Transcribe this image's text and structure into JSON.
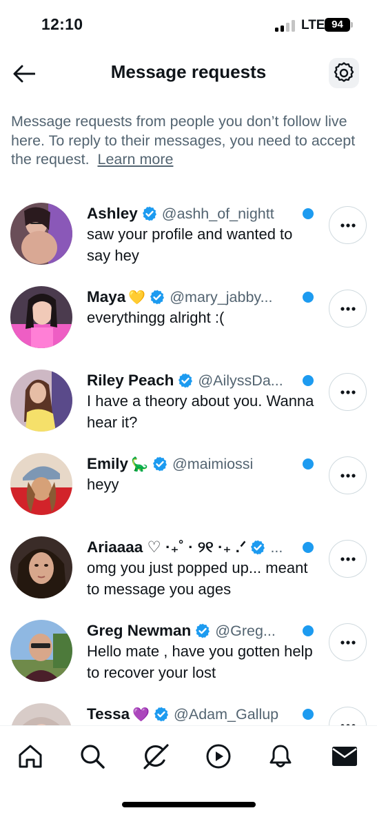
{
  "status_bar": {
    "time": "12:10",
    "network": "LTE",
    "battery": "94"
  },
  "header": {
    "title": "Message requests",
    "back_icon": "arrow-left-icon",
    "settings_icon": "gear-icon"
  },
  "description": {
    "text": "Message requests from people you don’t follow live here. To reply to their messages, you need to accept the request.",
    "link": "Learn more"
  },
  "requests": [
    {
      "name": "Ashley",
      "emoji": "",
      "verified": true,
      "handle": "@ashh_of_nightt",
      "preview": "saw your profile and wanted to say hey",
      "unread": true
    },
    {
      "name": "Maya",
      "emoji": "💛",
      "verified": true,
      "handle": "@mary_jabby...",
      "preview": "everythingg alright :(",
      "unread": true
    },
    {
      "name": "Riley Peach",
      "emoji": "",
      "verified": true,
      "handle": "@AilyssDa...",
      "preview": "I have a theory about you. Wanna hear it?",
      "unread": true
    },
    {
      "name": "Emily",
      "emoji": "🦕",
      "verified": true,
      "handle": "@maimiossi",
      "preview": "heyy",
      "unread": true
    },
    {
      "name": "Ariaaaa ♡ ·₊˚ · ୨୧ ·₊ .ᐟ",
      "emoji": "",
      "verified": true,
      "handle": "...",
      "preview": "omg you just popped up... meant to message you ages",
      "unread": true
    },
    {
      "name": "Greg Newman",
      "emoji": "",
      "verified": true,
      "handle": "@Greg...",
      "preview": "Hello mate , have you gotten help to recover your lost",
      "unread": true
    },
    {
      "name": "Tessa",
      "emoji": "💜",
      "verified": true,
      "handle": "@Adam_Gallup",
      "preview": "",
      "unread": true
    }
  ],
  "bottom_nav": [
    "home-icon",
    "search-icon",
    "grok-icon",
    "video-icon",
    "notifications-bell-icon",
    "messages-envelope-icon"
  ],
  "colors": {
    "accent": "#1d9bf0",
    "text": "#0f1419",
    "secondary_text": "#536471",
    "border": "#cfd9de"
  }
}
